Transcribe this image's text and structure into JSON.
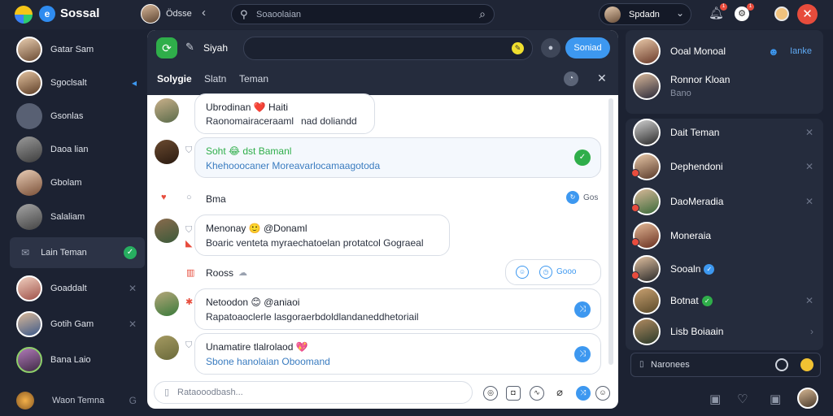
{
  "topbar": {
    "brand": "Sossal",
    "user_name": "Ödsse",
    "search_placeholder": "Soaoolaian",
    "profile_name": "Spdadn",
    "bell_badge": "1",
    "gear_badge": "1"
  },
  "left_sidebar": {
    "items": [
      {
        "label": "Gatar Sam",
        "action": ""
      },
      {
        "label": "Sgoclsalt",
        "action": "◂"
      },
      {
        "label": "Gsonlas",
        "action": ""
      },
      {
        "label": "Daoa lian",
        "action": ""
      },
      {
        "label": "Gbolam",
        "action": ""
      },
      {
        "label": "Salaliam",
        "action": ""
      },
      {
        "label": "Lain Teman",
        "action": "✓"
      },
      {
        "label": "Goaddalt",
        "action": "✕"
      },
      {
        "label": "Gotih Gam",
        "action": "✕"
      },
      {
        "label": "Bana Laio",
        "action": ""
      }
    ],
    "bottom": {
      "label": "Waon Temna",
      "action": "G"
    }
  },
  "chat": {
    "title": "Siyah",
    "send_label": "Soniad",
    "tabs": [
      "Solygie",
      "Slatn",
      "Teman"
    ],
    "messages": [
      {
        "title": "Ubrodinan ❤️ Haiti",
        "body": "Raonomairaceraaml",
        "tail": "nad doliandd"
      },
      {
        "title": "Soht 😂 dst Bamanl",
        "body": "Khehooocaner Moreavarlocamaagotoda"
      },
      {
        "title": "Bma",
        "right": "Gos"
      },
      {
        "title": "Menonay 🙂 @Donaml",
        "body": "Boaric venteta myraechatoelan protatcol Gograeal"
      },
      {
        "title": "Rooss",
        "right": "Gooo"
      },
      {
        "title": "Netoodon 😊 @aniaoi",
        "body": "Rapatoaoclerle lasgoraerbdoldlandaneddhetoriail"
      },
      {
        "title": "Unamatire tlalrolaod 💖",
        "body": "Sbone hanolaian Oboomand"
      }
    ],
    "composer_placeholder": "Rataooodbash...",
    "composer_icons": [
      "at-icon",
      "image-icon",
      "attach-icon",
      "link-icon",
      "send-icon",
      "emoji-icon"
    ]
  },
  "right_sidebar": {
    "top_items": [
      {
        "label": "Ooal Monoal",
        "tag": "Ianke"
      },
      {
        "label": "Ronnor Kloan",
        "sub": "Bano"
      }
    ],
    "items": [
      {
        "label": "Dait Teman"
      },
      {
        "label": "Dephendoni"
      },
      {
        "label": "DaoMeradia"
      },
      {
        "label": "Moneraia"
      },
      {
        "label": "Sooaln",
        "badge": "✓"
      },
      {
        "label": "Botnat",
        "badge": "✓"
      },
      {
        "label": "Lisb Boiaain"
      }
    ],
    "search_placeholder": "Naronees"
  },
  "colors": {
    "accent": "#3d98f0",
    "success": "#2fae4a",
    "danger": "#e74c3c"
  }
}
